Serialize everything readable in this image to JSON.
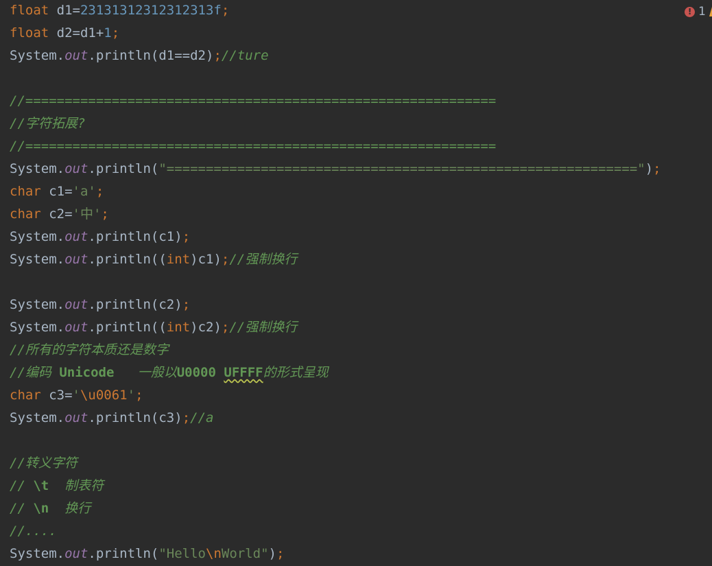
{
  "colors": {
    "background": "#2b2b2b",
    "text": "#a9b7c6",
    "keyword": "#cc7832",
    "number": "#6897bb",
    "field": "#9876aa",
    "string": "#6a8759",
    "comment": "#629755",
    "escape": "#cc7832",
    "error": "#c75450",
    "warning": "#e8a33c"
  },
  "inspection_widget": {
    "error_icon": "!",
    "error_count": "1",
    "warning_icon": "warning-triangle-icon"
  },
  "lines": [
    [
      {
        "t": "float",
        "c": "keyword"
      },
      {
        "t": " d1=",
        "c": "text"
      },
      {
        "t": "23131312312312313f",
        "c": "number"
      },
      {
        "t": ";",
        "c": "keyword"
      }
    ],
    [
      {
        "t": "float",
        "c": "keyword"
      },
      {
        "t": " d2=d1+",
        "c": "text"
      },
      {
        "t": "1",
        "c": "number"
      },
      {
        "t": ";",
        "c": "keyword"
      }
    ],
    [
      {
        "t": "System.",
        "c": "text"
      },
      {
        "t": "out",
        "c": "field",
        "s": "italic"
      },
      {
        "t": ".println(d1==d2)",
        "c": "text"
      },
      {
        "t": ";",
        "c": "keyword"
      },
      {
        "t": "//ture",
        "c": "comment",
        "s": "italic"
      }
    ],
    [],
    [
      {
        "t": "//============================================================",
        "c": "comment",
        "s": "italic"
      }
    ],
    [
      {
        "t": "//字符拓展?",
        "c": "comment",
        "s": "italic"
      }
    ],
    [
      {
        "t": "//============================================================",
        "c": "comment",
        "s": "italic"
      }
    ],
    [
      {
        "t": "System.",
        "c": "text"
      },
      {
        "t": "out",
        "c": "field",
        "s": "italic"
      },
      {
        "t": ".println(",
        "c": "text"
      },
      {
        "t": "\"============================================================\"",
        "c": "string"
      },
      {
        "t": ")",
        "c": "text"
      },
      {
        "t": ";",
        "c": "keyword"
      }
    ],
    [
      {
        "t": "char",
        "c": "keyword"
      },
      {
        "t": " c1=",
        "c": "text"
      },
      {
        "t": "'a'",
        "c": "string"
      },
      {
        "t": ";",
        "c": "keyword"
      }
    ],
    [
      {
        "t": "char",
        "c": "keyword"
      },
      {
        "t": " c2=",
        "c": "text"
      },
      {
        "t": "'中'",
        "c": "string"
      },
      {
        "t": ";",
        "c": "keyword"
      }
    ],
    [
      {
        "t": "System.",
        "c": "text"
      },
      {
        "t": "out",
        "c": "field",
        "s": "italic"
      },
      {
        "t": ".println(c1)",
        "c": "text"
      },
      {
        "t": ";",
        "c": "keyword"
      }
    ],
    [
      {
        "t": "System.",
        "c": "text"
      },
      {
        "t": "out",
        "c": "field",
        "s": "italic"
      },
      {
        "t": ".println((",
        "c": "text"
      },
      {
        "t": "int",
        "c": "keyword"
      },
      {
        "t": ")c1)",
        "c": "text"
      },
      {
        "t": ";",
        "c": "keyword"
      },
      {
        "t": "//强制换行",
        "c": "comment",
        "s": "italic"
      }
    ],
    [],
    [
      {
        "t": "System.",
        "c": "text"
      },
      {
        "t": "out",
        "c": "field",
        "s": "italic"
      },
      {
        "t": ".println(c2)",
        "c": "text"
      },
      {
        "t": ";",
        "c": "keyword"
      }
    ],
    [
      {
        "t": "System.",
        "c": "text"
      },
      {
        "t": "out",
        "c": "field",
        "s": "italic"
      },
      {
        "t": ".println((",
        "c": "text"
      },
      {
        "t": "int",
        "c": "keyword"
      },
      {
        "t": ")c2)",
        "c": "text"
      },
      {
        "t": ";",
        "c": "keyword"
      },
      {
        "t": "//强制换行",
        "c": "comment",
        "s": "italic"
      }
    ],
    [
      {
        "t": "//所有的字符本质还是数字",
        "c": "comment",
        "s": "italic"
      }
    ],
    [
      {
        "t": "//编码 ",
        "c": "comment",
        "s": "italic"
      },
      {
        "t": "Unicode",
        "c": "comment",
        "s": "bold"
      },
      {
        "t": "   一般以",
        "c": "comment",
        "s": "italic"
      },
      {
        "t": "U0000 ",
        "c": "comment",
        "s": "bold"
      },
      {
        "t": "UFFFF",
        "c": "comment",
        "s": "bold-wavy"
      },
      {
        "t": "的形式呈现",
        "c": "comment",
        "s": "italic"
      }
    ],
    [
      {
        "t": "char",
        "c": "keyword"
      },
      {
        "t": " c3=",
        "c": "text"
      },
      {
        "t": "'",
        "c": "string"
      },
      {
        "t": "\\u0061",
        "c": "escape"
      },
      {
        "t": "'",
        "c": "string"
      },
      {
        "t": ";",
        "c": "keyword"
      }
    ],
    [
      {
        "t": "System.",
        "c": "text"
      },
      {
        "t": "out",
        "c": "field",
        "s": "italic"
      },
      {
        "t": ".println(c3)",
        "c": "text"
      },
      {
        "t": ";",
        "c": "keyword"
      },
      {
        "t": "//a",
        "c": "comment",
        "s": "italic"
      }
    ],
    [],
    [
      {
        "t": "//转义字符",
        "c": "comment",
        "s": "italic"
      }
    ],
    [
      {
        "t": "// ",
        "c": "comment",
        "s": "italic"
      },
      {
        "t": "\\t",
        "c": "comment",
        "s": "bold"
      },
      {
        "t": "  制表符",
        "c": "comment",
        "s": "italic"
      }
    ],
    [
      {
        "t": "// ",
        "c": "comment",
        "s": "italic"
      },
      {
        "t": "\\n",
        "c": "comment",
        "s": "bold"
      },
      {
        "t": "  换行",
        "c": "comment",
        "s": "italic"
      }
    ],
    [
      {
        "t": "//....",
        "c": "comment",
        "s": "italic"
      }
    ],
    [
      {
        "t": "System.",
        "c": "text"
      },
      {
        "t": "out",
        "c": "field",
        "s": "italic"
      },
      {
        "t": ".println(",
        "c": "text"
      },
      {
        "t": "\"Hello",
        "c": "string"
      },
      {
        "t": "\\n",
        "c": "escape"
      },
      {
        "t": "World\"",
        "c": "string"
      },
      {
        "t": ")",
        "c": "text"
      },
      {
        "t": ";",
        "c": "keyword"
      }
    ]
  ]
}
